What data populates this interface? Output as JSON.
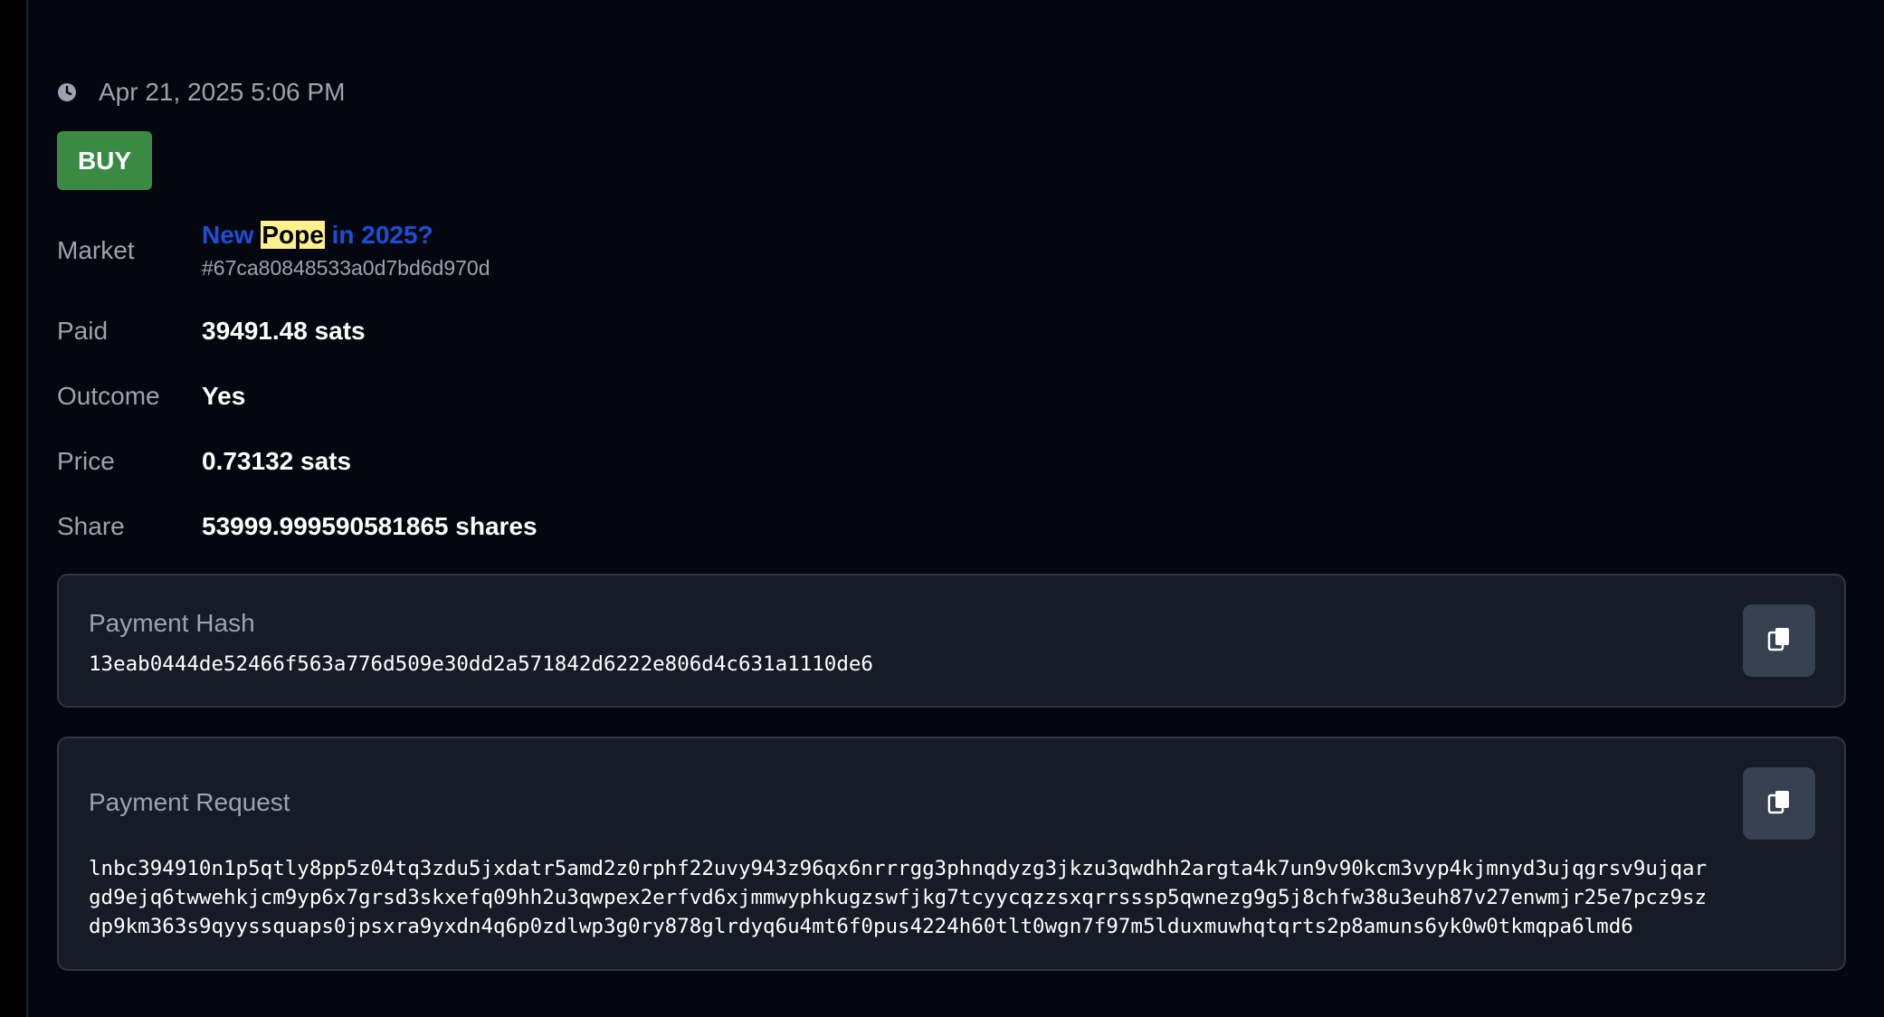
{
  "timestamp": "Apr 21, 2025 5:06 PM",
  "side_badge": "BUY",
  "market": {
    "label": "Market",
    "title_prefix": "New",
    "title_highlight": "Pope",
    "title_suffix": "in 2025?",
    "id": "#67ca80848533a0d7bd6d970d"
  },
  "fields": {
    "paid": {
      "label": "Paid",
      "value": "39491.48 sats"
    },
    "outcome": {
      "label": "Outcome",
      "value": "Yes"
    },
    "price": {
      "label": "Price",
      "value": "0.73132 sats"
    },
    "share": {
      "label": "Share",
      "value": "53999.999590581865 shares"
    }
  },
  "payment_hash": {
    "label": "Payment Hash",
    "value": "13eab0444de52466f563a776d509e30dd2a571842d6222e806d4c631a1110de6"
  },
  "payment_request": {
    "label": "Payment Request",
    "lines": [
      "lnbc394910n1p5qtly8pp5z04tq3zdu5jxdatr5amd2z0rphf22uvy943z96qx6nrrrgg3phnqdyzg3jkzu3qwdhh2argta4k7un9v90kcm3vyp4kjmnyd3ujqgrsv9ujqar",
      "gd9ejq6twwehkjcm9yp6x7grsd3skxefq09hh2u3qwpex2erfvd6xjmmwyphkugzswfjkg7tcyycqzzsxqrrsssp5qwnezg9g5j8chfw38u3euh87v27enwmjr25e7pcz9sz",
      "dp9km363s9qyyssquaps0jpsxra9yxdn4q6p0zdlwp3g0ry878glrdyq6u4mt6f0pus4224h60tlt0wgn7f97m5lduxmuwhqtqrts2p8amuns6yk0w0tkmqpa6lmd6"
    ]
  },
  "icons": {
    "clock": "clock-icon",
    "copy": "copy-icon"
  },
  "colors": {
    "buy_badge": "#3b8a44",
    "market_link": "#1d4ed8",
    "highlight": "#fef08a"
  }
}
